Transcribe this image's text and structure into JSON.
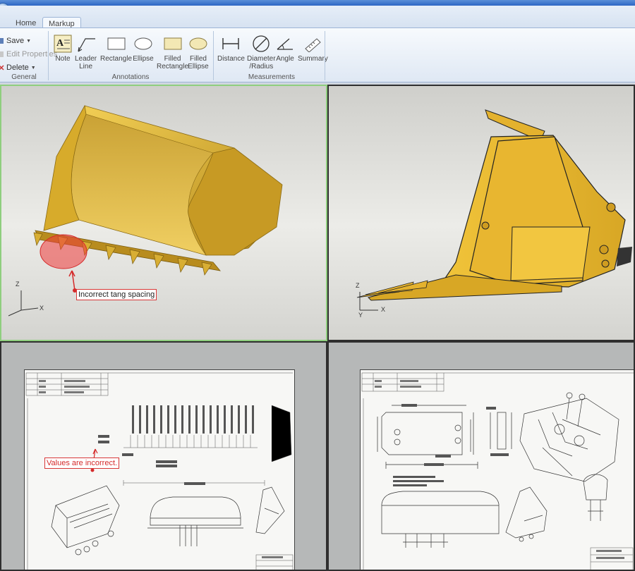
{
  "tabs": [
    {
      "label": "Home",
      "active": false
    },
    {
      "label": "Markup",
      "active": true
    }
  ],
  "ribbon": {
    "general": {
      "caption": "General",
      "buttons": [
        {
          "label": "Save",
          "dropdown": true,
          "enabled": true,
          "icon": "save-icon"
        },
        {
          "label": "Edit Properties",
          "dropdown": false,
          "enabled": false,
          "icon": "edit-properties-icon"
        },
        {
          "label": "Delete",
          "dropdown": true,
          "enabled": true,
          "icon": "delete-icon"
        }
      ]
    },
    "annotations": {
      "caption": "Annotations",
      "buttons": [
        {
          "label": "Note",
          "icon": "note-icon"
        },
        {
          "label": "Leader\nLine",
          "icon": "leader-line-icon"
        },
        {
          "label": "Rectangle",
          "icon": "rectangle-icon"
        },
        {
          "label": "Ellipse",
          "icon": "ellipse-icon"
        },
        {
          "label": "Filled\nRectangle",
          "icon": "filled-rectangle-icon"
        },
        {
          "label": "Filled\nEllipse",
          "icon": "filled-ellipse-icon"
        }
      ]
    },
    "measurements": {
      "caption": "Measurements",
      "buttons": [
        {
          "label": "Distance",
          "icon": "distance-icon"
        },
        {
          "label": "Diameter\n/Radius",
          "icon": "diameter-radius-icon"
        },
        {
          "label": "Angle",
          "icon": "angle-icon"
        },
        {
          "label": "Summary",
          "icon": "summary-icon"
        }
      ]
    }
  },
  "viewports": {
    "top_left": {
      "markup_text": "Incorrect tang spacing",
      "axes": {
        "z": "Z",
        "x": "X"
      }
    },
    "top_right": {
      "axes": {
        "z": "Z",
        "y": "Y",
        "x": "X"
      }
    },
    "bottom_left": {
      "markup_text": "Values are incorrect."
    }
  },
  "colors": {
    "accent_active_viewport": "#8fce7e",
    "markup_red": "#d83636",
    "bucket_yellow": "#e2b530",
    "ribbon_border": "#9db5d6"
  }
}
